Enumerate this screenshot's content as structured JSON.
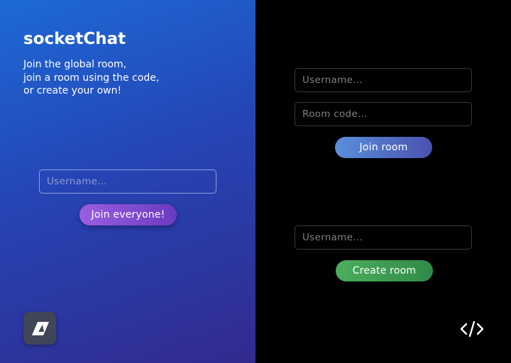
{
  "app": {
    "title": "socketChat",
    "intro_lines": [
      "Join the global room,",
      "join a room using the code,",
      "or create your own!"
    ]
  },
  "global": {
    "username_placeholder": "Username...",
    "button_label": "Join everyone!"
  },
  "join_room": {
    "username_placeholder": "Username...",
    "room_code_placeholder": "Room code...",
    "button_label": "Join room"
  },
  "create_room": {
    "username_placeholder": "Username...",
    "button_label": "Create room"
  },
  "icons": {
    "logo": "app-logo-icon",
    "source": "code-icon"
  },
  "colors": {
    "left_panel_top": "#1d6ad6",
    "left_panel_bottom": "#322a8f",
    "join_everyone_button": "#8a50d8",
    "join_room_button": "#5270c4",
    "create_room_button": "#3f9e52"
  }
}
